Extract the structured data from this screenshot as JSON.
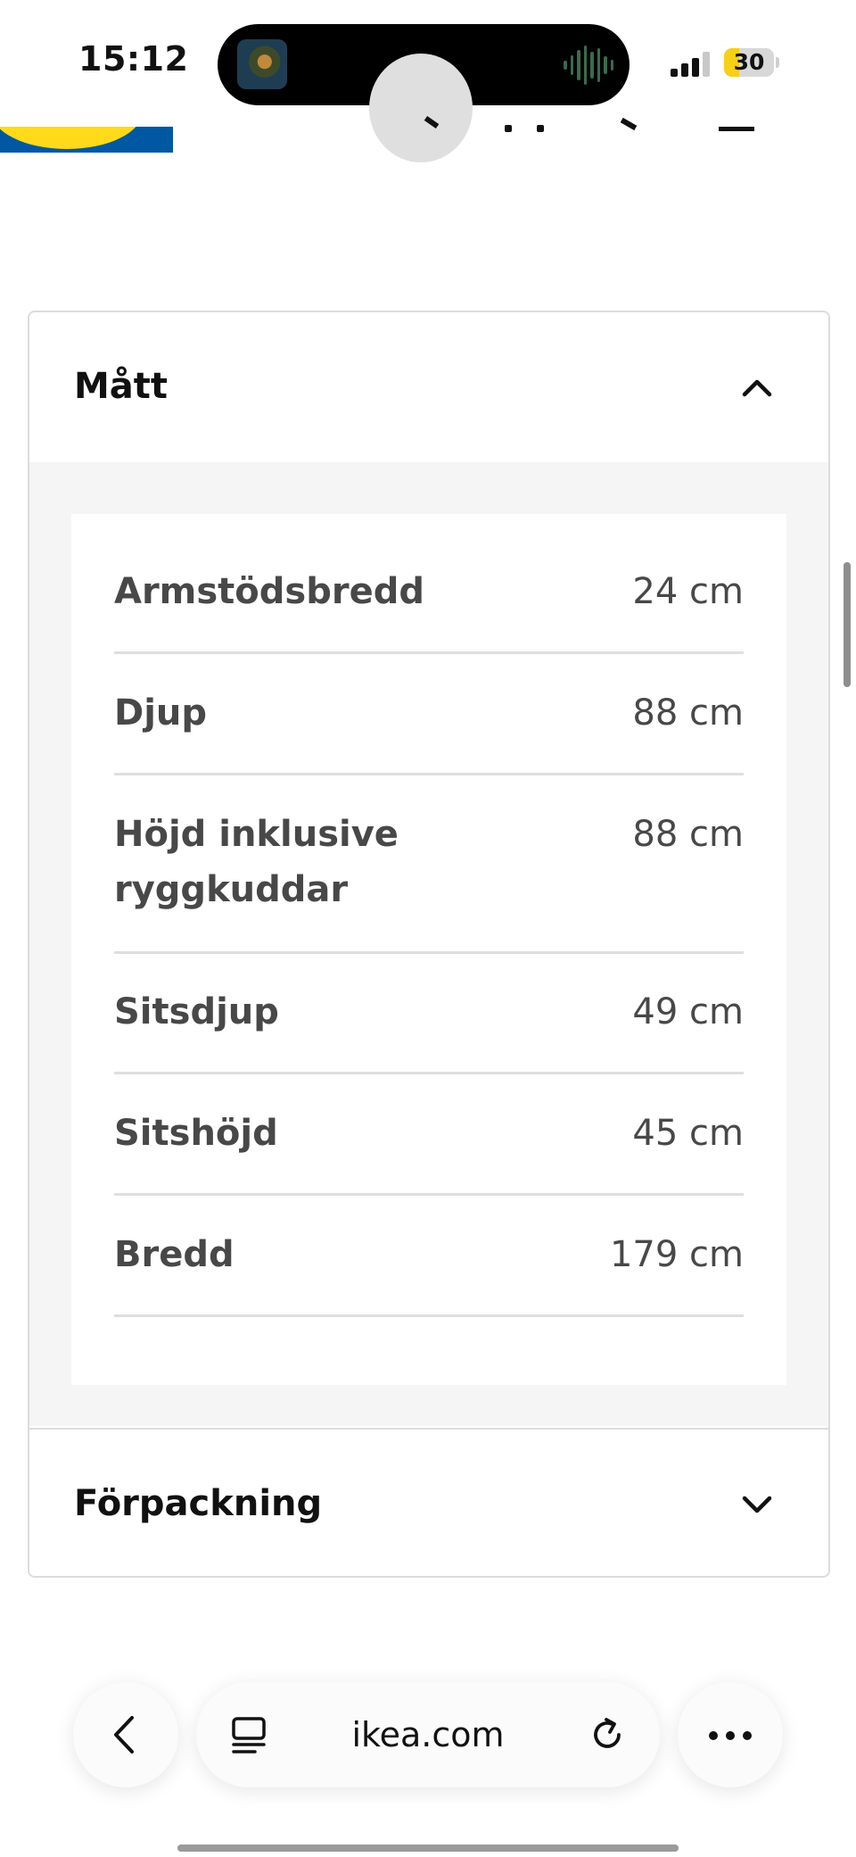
{
  "status_bar": {
    "time": "15:12",
    "battery": "30",
    "battery_level_percent": 30
  },
  "site_header": {
    "logo_colors": [
      "#0058a3",
      "#ffda1a"
    ]
  },
  "accordion": [
    {
      "title": "Mått",
      "expanded": true,
      "chevron": "chevron-up-icon",
      "rows": [
        {
          "label": "Armstödsbredd",
          "value": "24 cm"
        },
        {
          "label": "Djup",
          "value": "88 cm"
        },
        {
          "label": "Höjd inklusive ryggkuddar",
          "value": "88 cm"
        },
        {
          "label": "Sitsdjup",
          "value": "49 cm"
        },
        {
          "label": "Sitshöjd",
          "value": "45 cm"
        },
        {
          "label": "Bredd",
          "value": "179 cm"
        }
      ]
    },
    {
      "title": "Förpackning",
      "expanded": false,
      "chevron": "chevron-down-icon"
    }
  ],
  "browser_bar": {
    "url": "ikea.com",
    "icons": [
      "back-arrow-icon",
      "tab-overview-icon",
      "reload-icon",
      "more-icon"
    ]
  }
}
